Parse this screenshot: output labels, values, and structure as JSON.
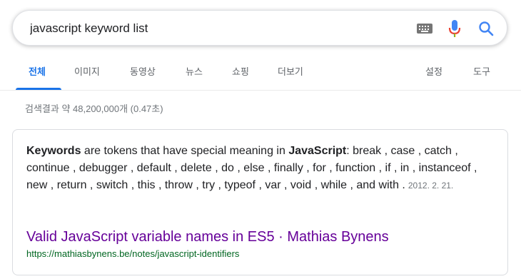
{
  "search": {
    "query": "javascript keyword list",
    "icons": [
      "keyboard-icon",
      "microphone-icon",
      "search-icon"
    ]
  },
  "tabs": [
    {
      "label": "전체",
      "active": true
    },
    {
      "label": "이미지",
      "active": false
    },
    {
      "label": "동영상",
      "active": false
    },
    {
      "label": "뉴스",
      "active": false
    },
    {
      "label": "쇼핑",
      "active": false
    },
    {
      "label": "더보기",
      "active": false
    },
    {
      "label": "설정",
      "active": false
    },
    {
      "label": "도구",
      "active": false
    }
  ],
  "stats": "검색결과 약 48,200,000개 (0.47초)",
  "featured": {
    "snippet_bold_1": "Keywords",
    "snippet_text_1": " are tokens that have special meaning in ",
    "snippet_bold_2": "JavaScript",
    "snippet_text_2": ": break , case , catch , continue , debugger , default , delete , do , else , finally , for , function , if , in , instanceof , new , return , switch , this , throw , try , typeof , var , void , while , and with .",
    "date": "2012. 2. 21.",
    "title": "Valid JavaScript variable names in ES5 · Mathias Bynens",
    "url": "https://mathiasbynens.be/notes/javascript-identifiers"
  },
  "colors": {
    "accent": "#1a73e8",
    "visited_link": "#660099",
    "url_green": "#006621",
    "mic_blue": "#4285f4",
    "mic_red": "#ea4335"
  }
}
